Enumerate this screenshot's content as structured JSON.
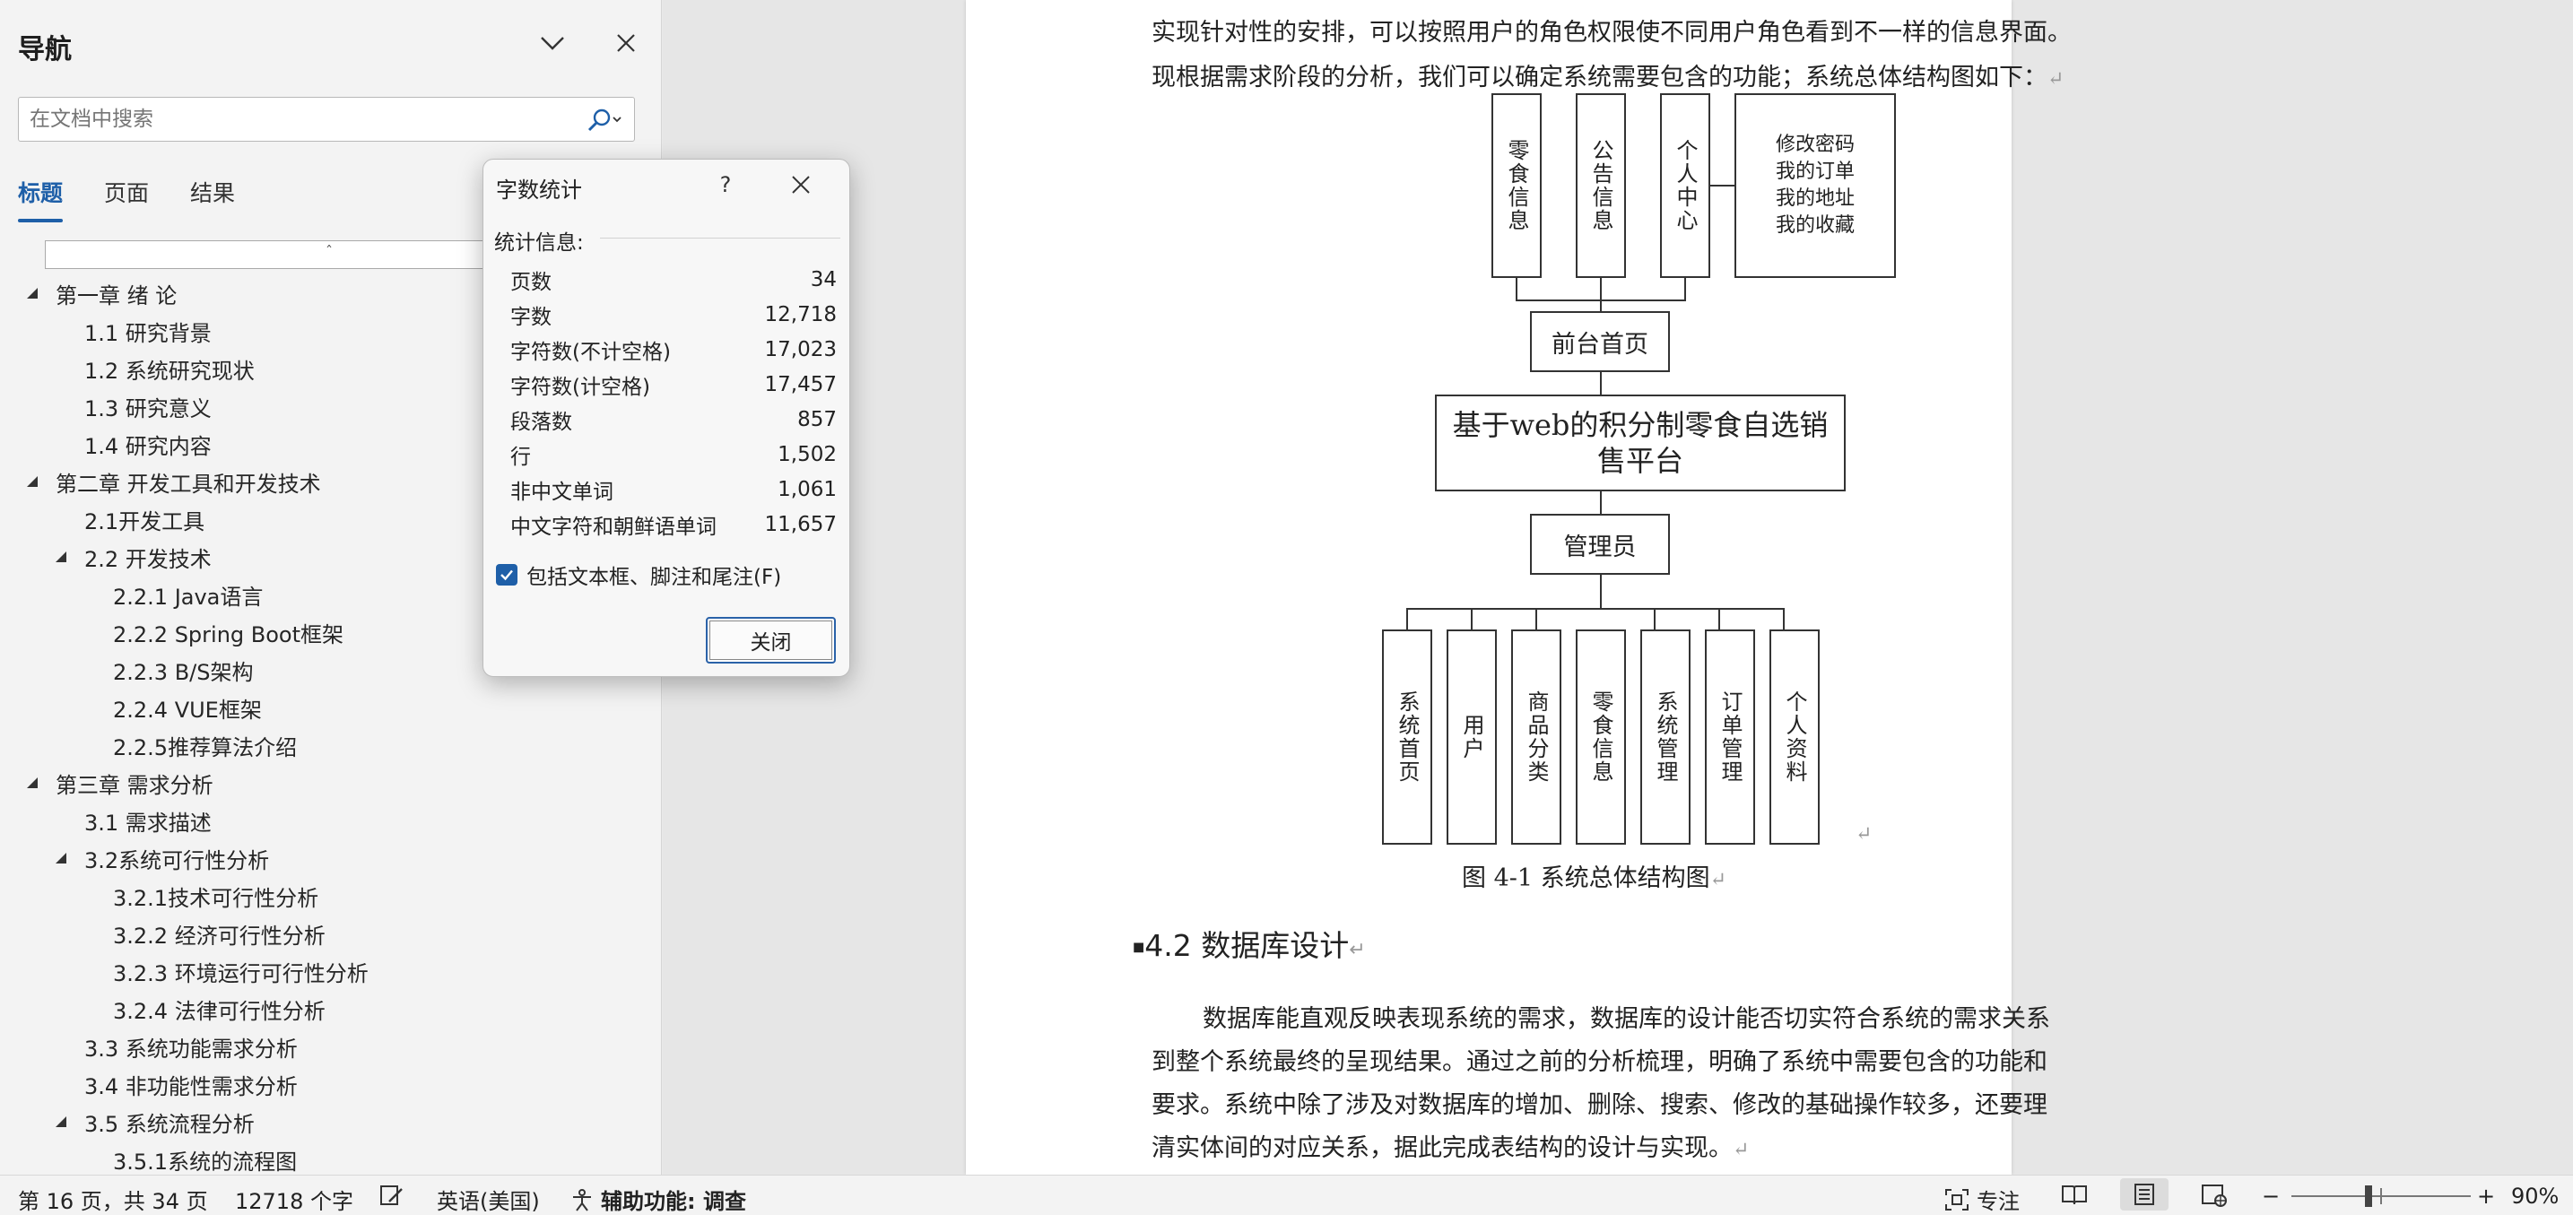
{
  "nav": {
    "title": "导航",
    "search_placeholder": "在文档中搜索",
    "tabs": [
      "标题",
      "页面",
      "结果"
    ],
    "collapse_glyph": "ˆ",
    "items": [
      {
        "label": "第一章 绪  论",
        "level": 1,
        "expanded": true
      },
      {
        "label": "1.1 研究背景",
        "level": 2
      },
      {
        "label": "1.2 系统研究现状",
        "level": 2
      },
      {
        "label": "1.3 研究意义",
        "level": 2
      },
      {
        "label": "1.4 研究内容",
        "level": 2
      },
      {
        "label": "第二章 开发工具和开发技术",
        "level": 1,
        "expanded": true
      },
      {
        "label": "2.1开发工具",
        "level": 2
      },
      {
        "label": "2.2 开发技术",
        "level": 2,
        "expanded": true
      },
      {
        "label": "2.2.1 Java语言",
        "level": 3
      },
      {
        "label": "2.2.2 Spring Boot框架",
        "level": 3
      },
      {
        "label": "2.2.3 B/S架构",
        "level": 3
      },
      {
        "label": "2.2.4 VUE框架",
        "level": 3
      },
      {
        "label": "2.2.5推荐算法介绍",
        "level": 3
      },
      {
        "label": "第三章 需求分析",
        "level": 1,
        "expanded": true
      },
      {
        "label": "3.1 需求描述",
        "level": 2
      },
      {
        "label": "3.2系统可行性分析",
        "level": 2,
        "expanded": true
      },
      {
        "label": "3.2.1技术可行性分析",
        "level": 3
      },
      {
        "label": "3.2.2 经济可行性分析",
        "level": 3
      },
      {
        "label": "3.2.3 环境运行可行性分析",
        "level": 3
      },
      {
        "label": "3.2.4 法律可行性分析",
        "level": 3
      },
      {
        "label": "3.3 系统功能需求分析",
        "level": 2
      },
      {
        "label": "3.4 非功能性需求分析",
        "level": 2
      },
      {
        "label": "3.5 系统流程分析",
        "level": 2,
        "expanded": true
      },
      {
        "label": "3.5.1系统的流程图",
        "level": 3
      }
    ]
  },
  "dialog": {
    "title": "字数统计",
    "help": "?",
    "section": "统计信息:",
    "stats": [
      {
        "label": "页数",
        "value": "34"
      },
      {
        "label": "字数",
        "value": "12,718"
      },
      {
        "label": "字符数(不计空格)",
        "value": "17,023"
      },
      {
        "label": "字符数(计空格)",
        "value": "17,457"
      },
      {
        "label": "段落数",
        "value": "857"
      },
      {
        "label": "行",
        "value": "1,502"
      },
      {
        "label": "非中文单词",
        "value": "1,061"
      },
      {
        "label": "中文字符和朝鲜语单词",
        "value": "11,657"
      }
    ],
    "checkbox_label": "包括文本框、脚注和尾注(F)",
    "checked": true,
    "close_button": "关闭"
  },
  "doc": {
    "line1": "实现针对性的安排，可以按照用户的角色权限使不同用户角色看到不一样的信息界面。",
    "line2": "现根据需求阶段的分析，我们可以确定系统需要包含的功能；系统总体结构图如下：",
    "para_mark": "↵",
    "diagram": {
      "top_boxes": [
        "零食信息",
        "公告信息",
        "个人中心"
      ],
      "top_right_lines": [
        "修改密码",
        "我的订单",
        "我的地址",
        "我的收藏"
      ],
      "front_page": "前台首页",
      "platform": "基于web的积分制零食自选销售平台",
      "admin": "管理员",
      "bottom_boxes": [
        "系统首页",
        "用户",
        "商品分类",
        "零食信息",
        "系统管理",
        "订单管理",
        "个人资料"
      ]
    },
    "caption": "图 4-1  系统总体结构图",
    "heading": "4.2  数据库设计",
    "body": [
      "数据库能直观反映表现系统的需求，数据库的设计能否切实符合系统的需求关系",
      "到整个系统最终的呈现结果。通过之前的分析梳理，明确了系统中需要包含的功能和",
      "要求。系统中除了涉及对数据库的增加、删除、搜索、修改的基础操作较多，还要理",
      "清实体间的对应关系，据此完成表结构的设计与实现。"
    ]
  },
  "status": {
    "page": "第 16 页，共 34 页",
    "words": "12718 个字",
    "language": "英语(美国)",
    "accessibility": "辅助功能: 调查",
    "focus": "专注",
    "zoom_minus": "−",
    "zoom_plus": "+",
    "zoom": "90%",
    "zoom_fraction": 0.43
  }
}
